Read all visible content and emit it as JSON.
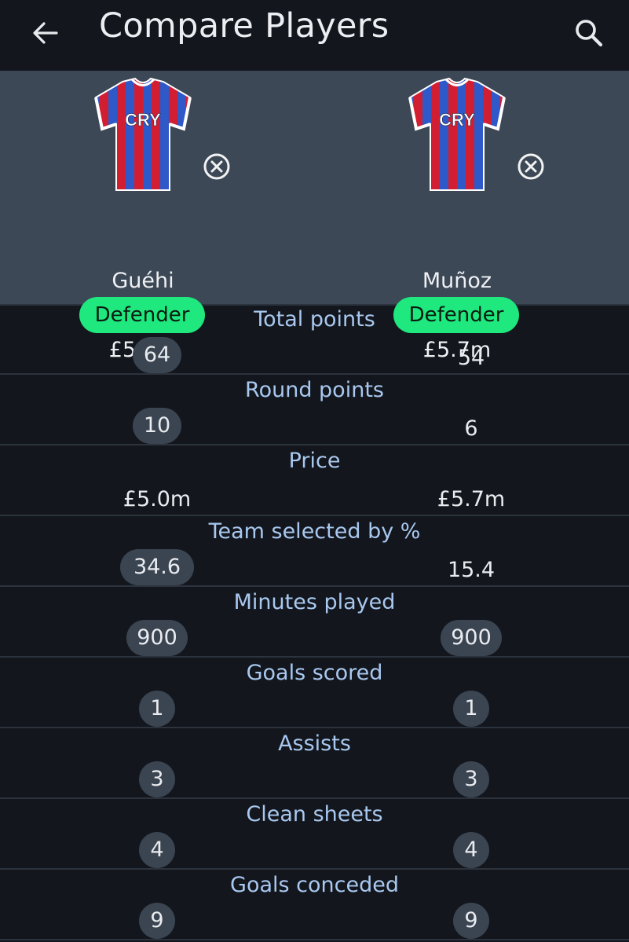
{
  "header": {
    "title": "Compare Players"
  },
  "players": [
    {
      "name": "Guéhi",
      "position": "Defender",
      "price": "£5.0m",
      "kit_text": "CRY"
    },
    {
      "name": "Muñoz",
      "position": "Defender",
      "price": "£5.7m",
      "kit_text": "CRY"
    }
  ],
  "stats": [
    {
      "label": "Total points",
      "p1": "64",
      "p2": "54",
      "highlight": "p1"
    },
    {
      "label": "Round points",
      "p1": "10",
      "p2": "6",
      "highlight": "p1"
    },
    {
      "label": "Price",
      "p1": "£5.0m",
      "p2": "£5.7m",
      "highlight": "none"
    },
    {
      "label": "Team selected by %",
      "p1": "34.6",
      "p2": "15.4",
      "highlight": "p1"
    },
    {
      "label": "Minutes played",
      "p1": "900",
      "p2": "900",
      "highlight": "both"
    },
    {
      "label": "Goals scored",
      "p1": "1",
      "p2": "1",
      "highlight": "both"
    },
    {
      "label": "Assists",
      "p1": "3",
      "p2": "3",
      "highlight": "both"
    },
    {
      "label": "Clean sheets",
      "p1": "4",
      "p2": "4",
      "highlight": "both"
    },
    {
      "label": "Goals conceded",
      "p1": "9",
      "p2": "9",
      "highlight": "both"
    }
  ],
  "colors": {
    "background": "#13171d",
    "player_panel": "#3c4856",
    "position_badge": "#1ee87e",
    "stat_label": "#a9c8f0",
    "value_badge": "#3b4552",
    "kit_blue": "#2f58c8",
    "kit_red": "#d21e32"
  },
  "icons": {
    "back": "arrow-left-icon",
    "search": "search-icon",
    "remove": "close-circle-icon"
  }
}
